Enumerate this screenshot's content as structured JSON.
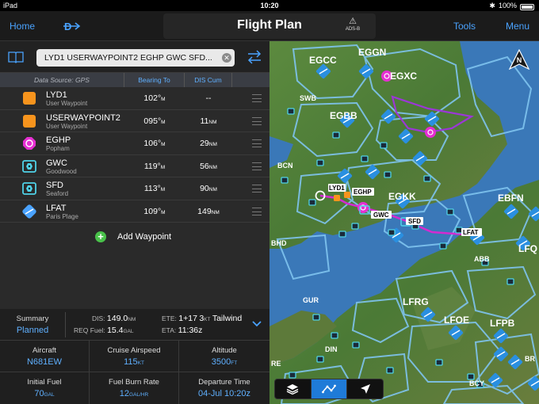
{
  "status_bar": {
    "device": "iPad",
    "time": "10:20",
    "battery": "100%"
  },
  "nav": {
    "home_label": "Home",
    "title": "Flight Plan",
    "adsb_label": "ADS-B",
    "tools_label": "Tools",
    "menu_label": "Menu"
  },
  "route": {
    "value": "LYD1 USERWAYPOINT2 EGHP GWC SFD..."
  },
  "table": {
    "headers": {
      "source": "Data Source: GPS",
      "bearing": "Bearing To",
      "distance": "DIS Cum"
    },
    "rows": [
      {
        "id": "LYD1",
        "name": "User Waypoint",
        "bearing": "102°",
        "bearing_unit": "M",
        "distance": "--",
        "distance_unit": "",
        "icon": "user-waypoint-icon",
        "color": "#f7941d"
      },
      {
        "id": "USERWAYPOINT2",
        "name": "User Waypoint",
        "bearing": "095°",
        "bearing_unit": "M",
        "distance": "11",
        "distance_unit": "NM",
        "icon": "user-waypoint-icon",
        "color": "#f7941d"
      },
      {
        "id": "EGHP",
        "name": "Popham",
        "bearing": "106°",
        "bearing_unit": "M",
        "distance": "29",
        "distance_unit": "NM",
        "icon": "airport-icon",
        "color": "#e62fd2"
      },
      {
        "id": "GWC",
        "name": "Goodwood",
        "bearing": "119°",
        "bearing_unit": "M",
        "distance": "56",
        "distance_unit": "NM",
        "icon": "vor-icon",
        "color": "#4fd2e8"
      },
      {
        "id": "SFD",
        "name": "Seaford",
        "bearing": "113°",
        "bearing_unit": "M",
        "distance": "90",
        "distance_unit": "NM",
        "icon": "vor-icon",
        "color": "#4fd2e8"
      },
      {
        "id": "LFAT",
        "name": "Paris Plage",
        "bearing": "109°",
        "bearing_unit": "M",
        "distance": "149",
        "distance_unit": "NM",
        "icon": "airport-icon",
        "color": "#4aa3ff"
      }
    ],
    "add_label": "Add Waypoint"
  },
  "summary": {
    "label": "Summary",
    "status": "Planned",
    "dis_label": "DIS:",
    "dis_value": "149.0",
    "dis_unit": "NM",
    "fuel_label": "REQ Fuel:",
    "fuel_value": "15.4",
    "fuel_unit": "GAL",
    "ete_label": "ETE:",
    "ete_value": "1+17",
    "wind_value": "3",
    "wind_unit": "KT",
    "wind_text": "Tailwind",
    "eta_label": "ETA:",
    "eta_value": "11:36z",
    "cells": [
      {
        "label": "Aircraft",
        "value": "N681EW",
        "unit": ""
      },
      {
        "label": "Cruise Airspeed",
        "value": "115",
        "unit": "KT"
      },
      {
        "label": "Altitude",
        "value": "3500",
        "unit": "FT"
      },
      {
        "label": "Initial Fuel",
        "value": "70",
        "unit": "GAL"
      },
      {
        "label": "Fuel Burn Rate",
        "value": "12",
        "unit": "GAL/HR"
      },
      {
        "label": "Departure Time",
        "value": "04-Jul 10:20z",
        "unit": ""
      }
    ]
  },
  "map": {
    "compass_label": "N",
    "labels": [
      "EGCC",
      "EGGN",
      "EGXC",
      "SWB",
      "EGBB",
      "BCN",
      "LYD1",
      "EGHP",
      "EGKK",
      "GWC",
      "SFD",
      "EBFN",
      "LFAT",
      "BHD",
      "ABB",
      "LFQ",
      "GUR",
      "LFRG",
      "LFOE",
      "LFPB",
      "DIN",
      "RE",
      "BCY",
      "BR"
    ],
    "colors": {
      "land": "#4a7a3a",
      "sea": "#3a78b8",
      "airspace": "#7fc4ef",
      "route": "#d42ad0"
    }
  }
}
